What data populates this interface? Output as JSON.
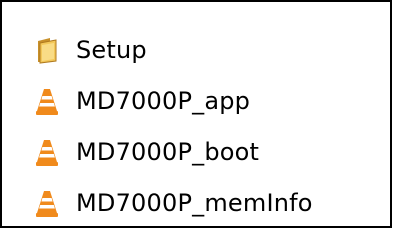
{
  "files": [
    {
      "name": "Setup",
      "icon": "folder-icon"
    },
    {
      "name": "MD7000P_app",
      "icon": "vlc-cone-icon"
    },
    {
      "name": "MD7000P_boot",
      "icon": "vlc-cone-icon"
    },
    {
      "name": "MD7000P_memInfo",
      "icon": "vlc-cone-icon"
    }
  ],
  "colors": {
    "folder": "#e8b84a",
    "cone_orange": "#f08a1c",
    "cone_stripe": "#ffffff",
    "border": "#000000"
  }
}
